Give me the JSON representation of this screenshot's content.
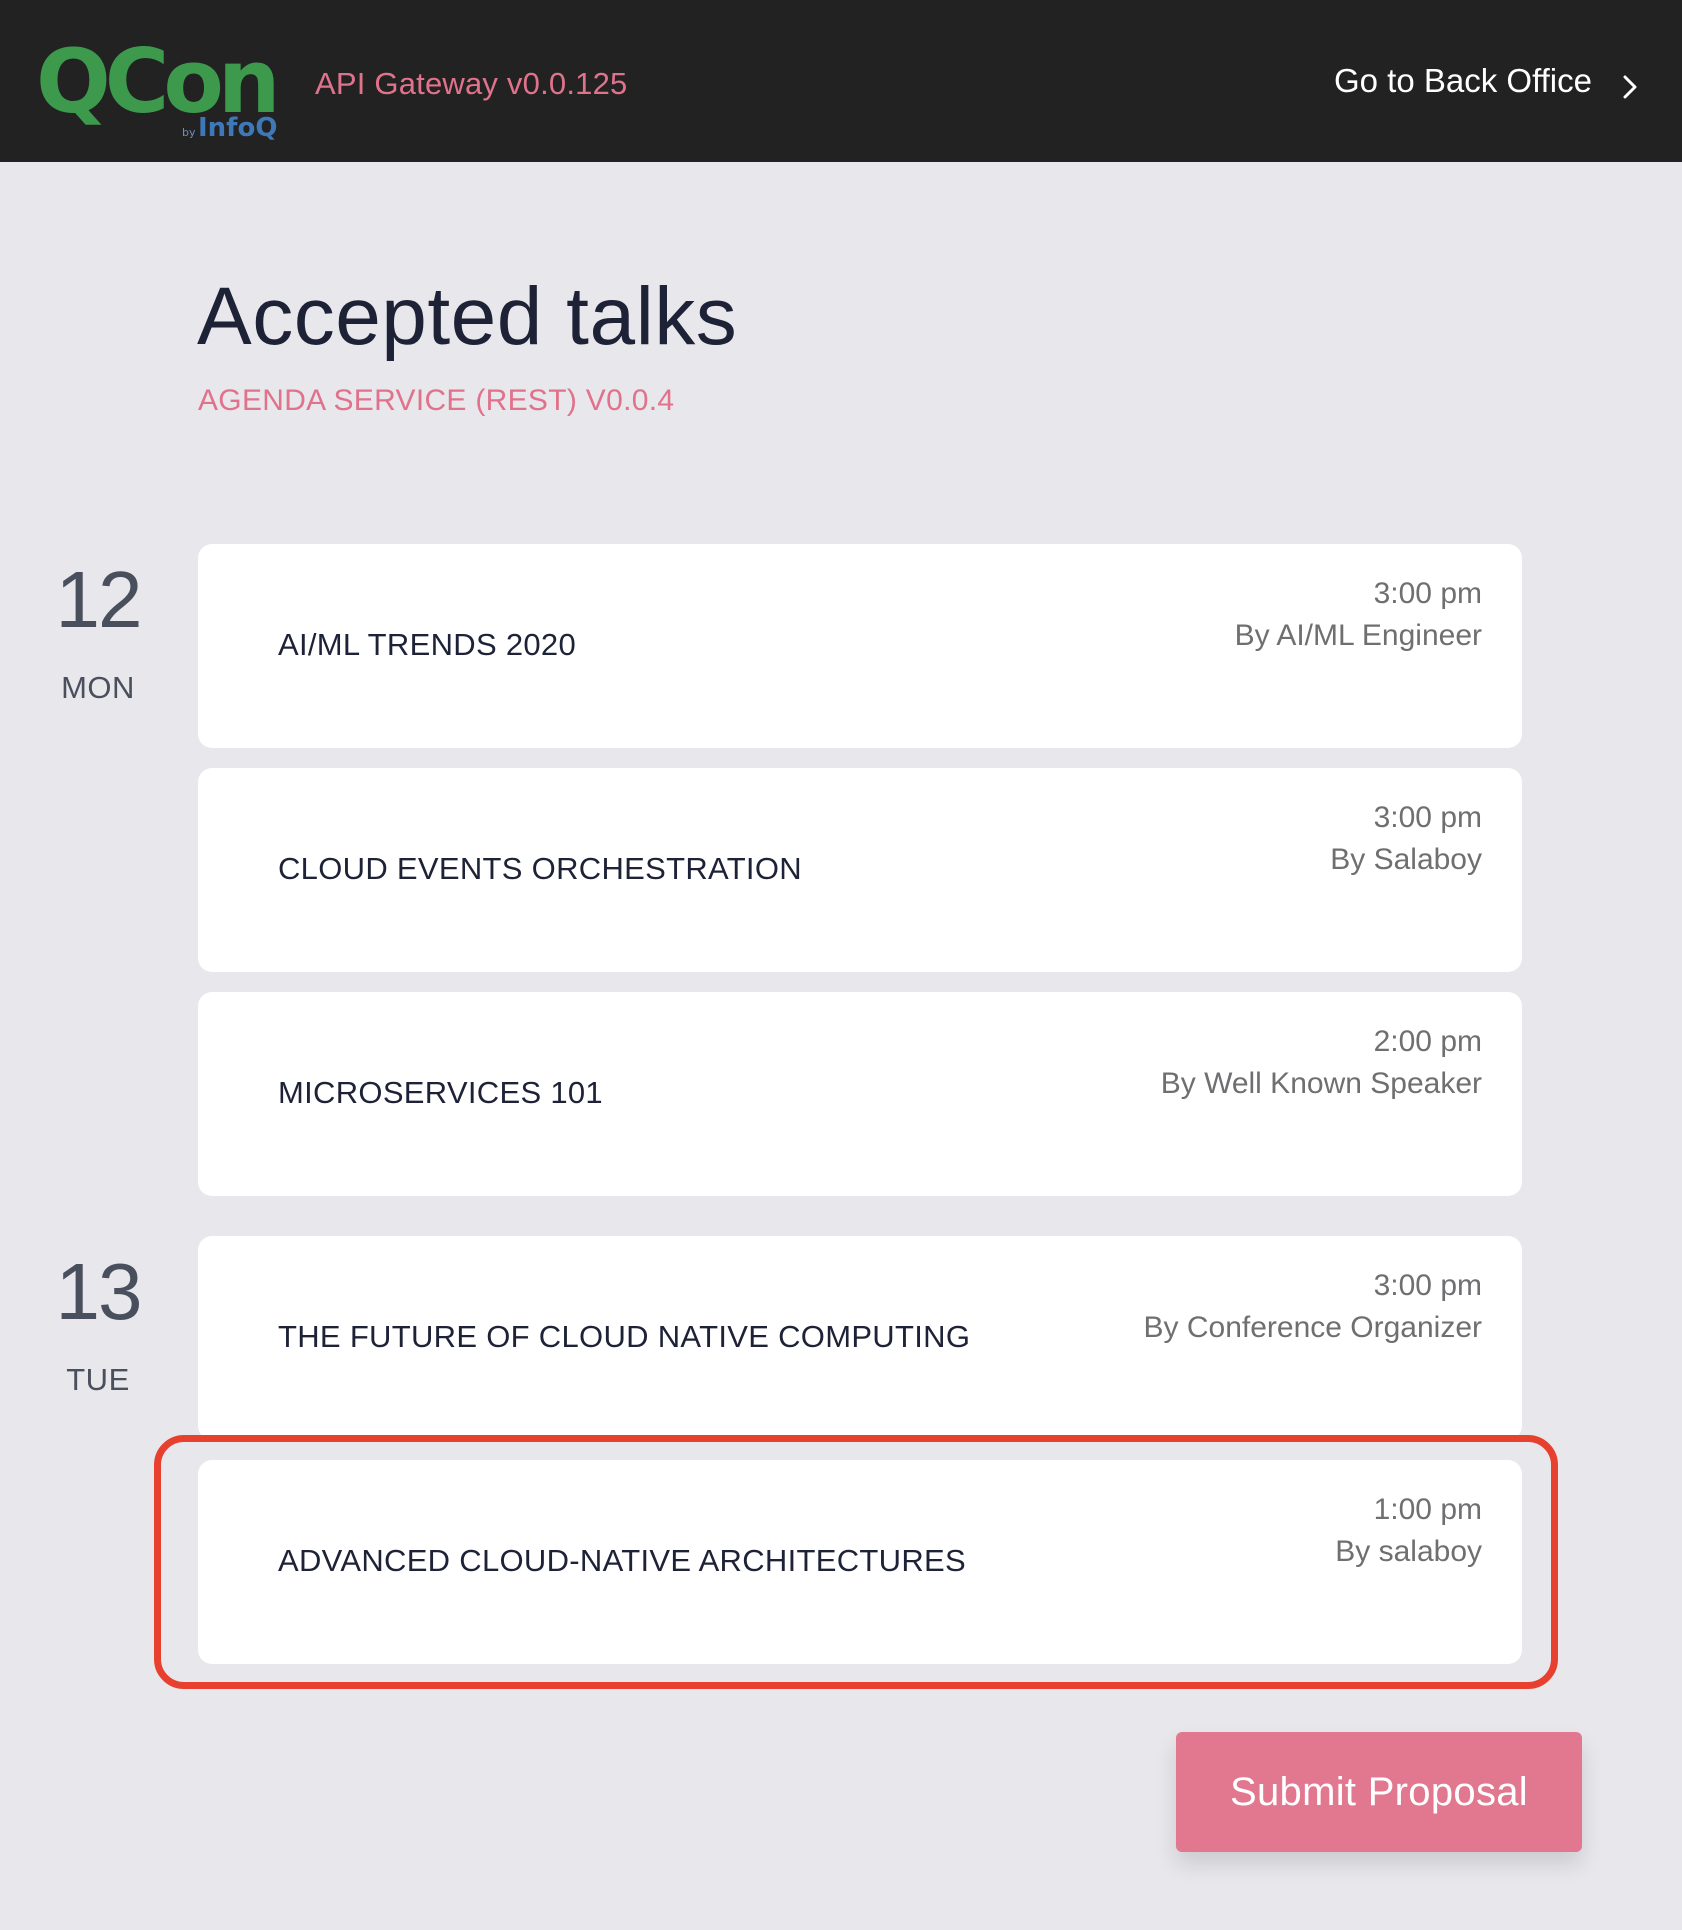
{
  "header": {
    "logo": {
      "main": "QCon",
      "by": "by",
      "sub": "InfoQ",
      "colors": {
        "green": "#3d9a4d",
        "blue": "#3e78b8"
      }
    },
    "gateway_version": "API Gateway v0.0.125",
    "back_office_label": "Go to Back Office",
    "back_office_icon": "chevron-right-icon"
  },
  "page": {
    "title": "Accepted talks",
    "subtitle": "AGENDA SERVICE (REST) V0.0.4"
  },
  "days": [
    {
      "num": "12",
      "dow": "MON"
    },
    {
      "num": "13",
      "dow": "TUE"
    }
  ],
  "talks": [
    {
      "title": "AI/ML TRENDS 2020",
      "time": "3:00 pm",
      "speaker": "By AI/ML Engineer"
    },
    {
      "title": "CLOUD EVENTS ORCHESTRATION",
      "time": "3:00 pm",
      "speaker": "By Salaboy"
    },
    {
      "title": "MICROSERVICES 101",
      "time": "2:00 pm",
      "speaker": "By Well Known Speaker"
    },
    {
      "title": "THE FUTURE OF CLOUD NATIVE COMPUTING",
      "time": "3:00 pm",
      "speaker": "By Conference Organizer"
    },
    {
      "title": "ADVANCED CLOUD-NATIVE ARCHITECTURES",
      "time": "1:00 pm",
      "speaker": "By salaboy"
    }
  ],
  "submit_label": "Submit Proposal",
  "colors": {
    "header_bg": "#222222",
    "accent_pink": "#e0728c",
    "page_bg": "#e8e7eb",
    "highlight_red": "#e8402f",
    "button_bg": "#e17890"
  }
}
